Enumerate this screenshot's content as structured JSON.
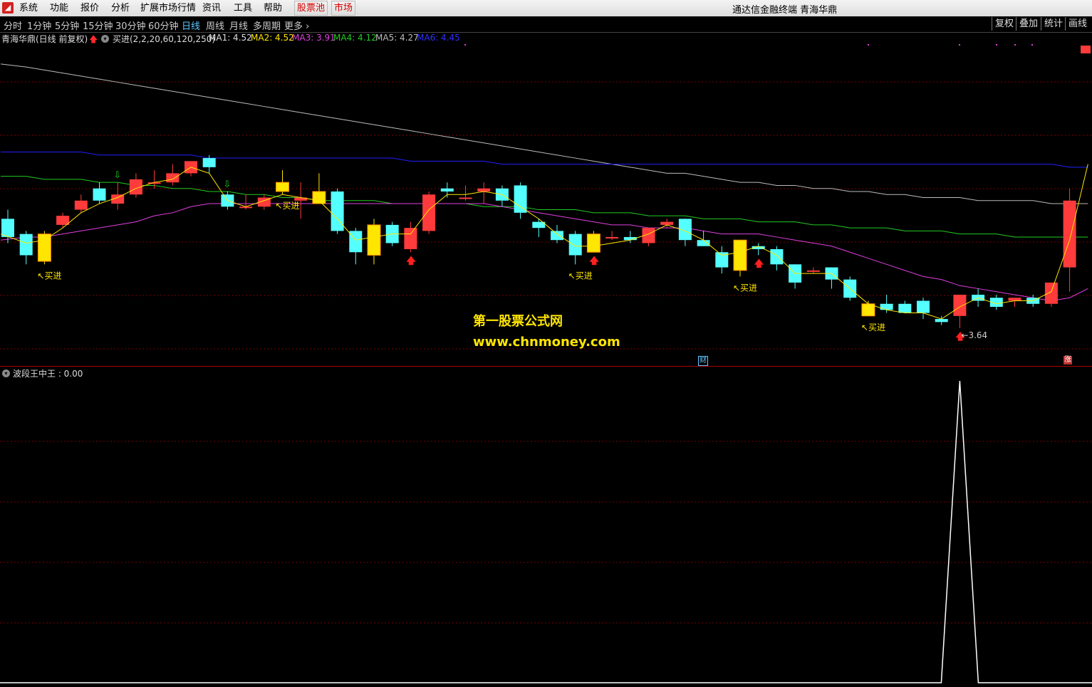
{
  "menubar": {
    "items": [
      "系统",
      "功能",
      "报价",
      "分析",
      "扩展市场行情",
      "资讯",
      "工具",
      "帮助"
    ],
    "stock_pool": "股票池",
    "market": "市场",
    "title": "通达信金融终端  青海华鼎"
  },
  "periods": [
    "分时",
    "1分钟",
    "5分钟",
    "15分钟",
    "30分钟",
    "60分钟",
    "日线",
    "周线",
    "月线",
    "多周期",
    "更多"
  ],
  "active_period": "日线",
  "tools": [
    "复权",
    "叠加",
    "统计",
    "画线"
  ],
  "legend": {
    "stock": "青海华鼎(日线 前复权)",
    "formula": "买进(2,2,20,60,120,250)",
    "ma1": "MA1: 4.52",
    "ma2": "MA2: 4.52",
    "ma3": "MA3: 3.91",
    "ma4": "MA4: 4.12",
    "ma5": "MA5: 4.27",
    "ma6": "MA6: 4.45"
  },
  "colors": {
    "up": "#ff3b3b",
    "down": "#54ffff",
    "signal": "#ffe600",
    "ma3": "#e040e0",
    "ma4": "#22cc22",
    "ma6": "#2020ff",
    "ma_gray": "#bbbbbb"
  },
  "watermark": {
    "line1": "第一股票公式网",
    "line2": "www.chnmoney.com"
  },
  "buy_label": "买进",
  "low_price": "3.64",
  "badges": {
    "cai": "财",
    "zhang": "涨"
  },
  "indicator": {
    "label": "波段王中王 : 0.00"
  },
  "chart_data": {
    "type": "candlestick",
    "candles": [
      {
        "o": 4.64,
        "h": 4.67,
        "l": 4.56,
        "c": 4.58
      },
      {
        "o": 4.59,
        "h": 4.6,
        "l": 4.49,
        "c": 4.52
      },
      {
        "o": 4.5,
        "h": 4.6,
        "l": 4.49,
        "c": 4.59,
        "hl": true
      },
      {
        "o": 4.62,
        "h": 4.66,
        "l": 4.61,
        "c": 4.65
      },
      {
        "o": 4.67,
        "h": 4.72,
        "l": 4.66,
        "c": 4.7
      },
      {
        "o": 4.74,
        "h": 4.76,
        "l": 4.69,
        "c": 4.7
      },
      {
        "o": 4.69,
        "h": 4.76,
        "l": 4.67,
        "c": 4.72
      },
      {
        "o": 4.72,
        "h": 4.79,
        "l": 4.71,
        "c": 4.77
      },
      {
        "o": 4.76,
        "h": 4.8,
        "l": 4.74,
        "c": 4.76
      },
      {
        "o": 4.76,
        "h": 4.82,
        "l": 4.75,
        "c": 4.79
      },
      {
        "o": 4.79,
        "h": 4.83,
        "l": 4.78,
        "c": 4.83
      },
      {
        "o": 4.84,
        "h": 4.85,
        "l": 4.79,
        "c": 4.81
      },
      {
        "o": 4.72,
        "h": 4.73,
        "l": 4.67,
        "c": 4.68
      },
      {
        "o": 4.68,
        "h": 4.72,
        "l": 4.67,
        "c": 4.68
      },
      {
        "o": 4.68,
        "h": 4.72,
        "l": 4.67,
        "c": 4.71
      },
      {
        "o": 4.76,
        "h": 4.8,
        "l": 4.72,
        "c": 4.73,
        "hl": true
      },
      {
        "o": 4.7,
        "h": 4.76,
        "l": 4.64,
        "c": 4.71
      },
      {
        "o": 4.73,
        "h": 4.79,
        "l": 4.7,
        "c": 4.69,
        "hl": true
      },
      {
        "o": 4.73,
        "h": 4.74,
        "l": 4.59,
        "c": 4.6
      },
      {
        "o": 4.6,
        "h": 4.61,
        "l": 4.49,
        "c": 4.53
      },
      {
        "o": 4.52,
        "h": 4.64,
        "l": 4.49,
        "c": 4.62,
        "hl": true
      },
      {
        "o": 4.62,
        "h": 4.63,
        "l": 4.55,
        "c": 4.56
      },
      {
        "o": 4.54,
        "h": 4.63,
        "l": 4.53,
        "c": 4.61
      },
      {
        "o": 4.6,
        "h": 4.73,
        "l": 4.59,
        "c": 4.72
      },
      {
        "o": 4.74,
        "h": 4.76,
        "l": 4.71,
        "c": 4.73
      },
      {
        "o": 4.71,
        "h": 4.75,
        "l": 4.7,
        "c": 4.71
      },
      {
        "o": 4.73,
        "h": 4.76,
        "l": 4.69,
        "c": 4.74
      },
      {
        "o": 4.74,
        "h": 4.75,
        "l": 4.68,
        "c": 4.7
      },
      {
        "o": 4.75,
        "h": 4.76,
        "l": 4.64,
        "c": 4.66
      },
      {
        "o": 4.63,
        "h": 4.64,
        "l": 4.58,
        "c": 4.61
      },
      {
        "o": 4.6,
        "h": 4.62,
        "l": 4.56,
        "c": 4.57
      },
      {
        "o": 4.59,
        "h": 4.6,
        "l": 4.49,
        "c": 4.52
      },
      {
        "o": 4.59,
        "h": 4.6,
        "l": 4.53,
        "c": 4.53,
        "hl": true
      },
      {
        "o": 4.58,
        "h": 4.6,
        "l": 4.57,
        "c": 4.58
      },
      {
        "o": 4.58,
        "h": 4.6,
        "l": 4.56,
        "c": 4.57
      },
      {
        "o": 4.56,
        "h": 4.61,
        "l": 4.55,
        "c": 4.61
      },
      {
        "o": 4.62,
        "h": 4.64,
        "l": 4.61,
        "c": 4.63
      },
      {
        "o": 4.64,
        "h": 4.64,
        "l": 4.55,
        "c": 4.57
      },
      {
        "o": 4.57,
        "h": 4.6,
        "l": 4.55,
        "c": 4.55
      },
      {
        "o": 4.53,
        "h": 4.55,
        "l": 4.46,
        "c": 4.48
      },
      {
        "o": 4.47,
        "h": 4.57,
        "l": 4.45,
        "c": 4.57,
        "hl": true
      },
      {
        "o": 4.55,
        "h": 4.56,
        "l": 4.52,
        "c": 4.54
      },
      {
        "o": 4.54,
        "h": 4.55,
        "l": 4.47,
        "c": 4.49
      },
      {
        "o": 4.49,
        "h": 4.49,
        "l": 4.41,
        "c": 4.43
      },
      {
        "o": 4.47,
        "h": 4.48,
        "l": 4.46,
        "c": 4.47
      },
      {
        "o": 4.48,
        "h": 4.48,
        "l": 4.41,
        "c": 4.44
      },
      {
        "o": 4.44,
        "h": 4.45,
        "l": 4.37,
        "c": 4.38
      },
      {
        "o": 4.36,
        "h": 4.37,
        "l": 4.32,
        "c": 4.32,
        "hl": true
      },
      {
        "o": 4.36,
        "h": 4.39,
        "l": 4.33,
        "c": 4.34
      },
      {
        "o": 4.36,
        "h": 4.37,
        "l": 4.33,
        "c": 4.33
      },
      {
        "o": 4.37,
        "h": 4.38,
        "l": 4.31,
        "c": 4.33
      },
      {
        "o": 4.31,
        "h": 4.32,
        "l": 4.29,
        "c": 4.3
      },
      {
        "o": 4.32,
        "h": 4.39,
        "l": 4.28,
        "c": 4.39
      },
      {
        "o": 4.39,
        "h": 4.41,
        "l": 4.35,
        "c": 4.37
      },
      {
        "o": 4.38,
        "h": 4.39,
        "l": 4.34,
        "c": 4.35
      },
      {
        "o": 4.37,
        "h": 4.38,
        "l": 4.35,
        "c": 4.38
      },
      {
        "o": 4.38,
        "h": 4.39,
        "l": 4.35,
        "c": 4.36
      },
      {
        "o": 4.36,
        "h": 4.43,
        "l": 4.35,
        "c": 4.43
      },
      {
        "o": 4.48,
        "h": 4.74,
        "l": 4.4,
        "c": 4.7
      }
    ],
    "ma_fast": [
      4.59,
      4.56,
      4.57,
      4.61,
      4.66,
      4.69,
      4.71,
      4.74,
      4.76,
      4.77,
      4.81,
      4.79,
      4.7,
      4.68,
      4.7,
      4.72,
      4.71,
      4.7,
      4.64,
      4.57,
      4.58,
      4.59,
      4.59,
      4.67,
      4.72,
      4.72,
      4.73,
      4.72,
      4.68,
      4.64,
      4.59,
      4.55,
      4.55,
      4.56,
      4.57,
      4.59,
      4.62,
      4.6,
      4.57,
      4.52,
      4.53,
      4.55,
      4.52,
      4.46,
      4.46,
      4.46,
      4.41,
      4.36,
      4.34,
      4.33,
      4.33,
      4.31,
      4.35,
      4.38,
      4.36,
      4.37,
      4.37,
      4.4,
      4.57,
      4.82
    ],
    "ma3": [
      4.57,
      4.58,
      4.58,
      4.59,
      4.6,
      4.61,
      4.62,
      4.63,
      4.65,
      4.66,
      4.68,
      4.69,
      4.69,
      4.69,
      4.69,
      4.69,
      4.69,
      4.69,
      4.69,
      4.69,
      4.69,
      4.69,
      4.69,
      4.69,
      4.69,
      4.69,
      4.69,
      4.68,
      4.67,
      4.66,
      4.65,
      4.64,
      4.63,
      4.62,
      4.62,
      4.61,
      4.61,
      4.61,
      4.6,
      4.59,
      4.59,
      4.59,
      4.58,
      4.57,
      4.56,
      4.55,
      4.53,
      4.51,
      4.49,
      4.47,
      4.45,
      4.44,
      4.42,
      4.41,
      4.4,
      4.39,
      4.38,
      4.37,
      4.38,
      4.41
    ],
    "ma4": [
      4.78,
      4.78,
      4.77,
      4.77,
      4.77,
      4.76,
      4.76,
      4.75,
      4.75,
      4.74,
      4.74,
      4.73,
      4.73,
      4.72,
      4.72,
      4.71,
      4.71,
      4.7,
      4.7,
      4.7,
      4.7,
      4.69,
      4.69,
      4.69,
      4.69,
      4.69,
      4.68,
      4.68,
      4.68,
      4.67,
      4.67,
      4.67,
      4.66,
      4.66,
      4.66,
      4.65,
      4.65,
      4.65,
      4.64,
      4.64,
      4.64,
      4.63,
      4.63,
      4.63,
      4.62,
      4.62,
      4.61,
      4.61,
      4.61,
      4.6,
      4.6,
      4.6,
      4.59,
      4.59,
      4.59,
      4.58,
      4.58,
      4.58,
      4.58,
      4.58
    ],
    "ma6": [
      4.86,
      4.86,
      4.86,
      4.86,
      4.86,
      4.85,
      4.85,
      4.85,
      4.85,
      4.85,
      4.85,
      4.84,
      4.84,
      4.84,
      4.84,
      4.84,
      4.84,
      4.84,
      4.84,
      4.84,
      4.84,
      4.84,
      4.83,
      4.83,
      4.83,
      4.83,
      4.83,
      4.82,
      4.82,
      4.82,
      4.82,
      4.82,
      4.82,
      4.82,
      4.82,
      4.82,
      4.82,
      4.82,
      4.82,
      4.82,
      4.82,
      4.82,
      4.82,
      4.82,
      4.82,
      4.82,
      4.82,
      4.82,
      4.82,
      4.82,
      4.82,
      4.82,
      4.82,
      4.82,
      4.82,
      4.82,
      4.82,
      4.82,
      4.81,
      4.81
    ],
    "ma_gray": [
      5.15,
      5.14,
      5.13,
      5.12,
      5.11,
      5.1,
      5.09,
      5.08,
      5.07,
      5.06,
      5.05,
      5.04,
      5.03,
      5.02,
      5.01,
      5.0,
      4.99,
      4.98,
      4.97,
      4.96,
      4.95,
      4.94,
      4.93,
      4.92,
      4.91,
      4.9,
      4.89,
      4.88,
      4.87,
      4.86,
      4.85,
      4.84,
      4.83,
      4.82,
      4.81,
      4.8,
      4.79,
      4.79,
      4.78,
      4.77,
      4.76,
      4.76,
      4.75,
      4.75,
      4.74,
      4.74,
      4.73,
      4.73,
      4.72,
      4.72,
      4.71,
      4.71,
      4.71,
      4.7,
      4.7,
      4.7,
      4.7,
      4.69,
      4.69,
      4.69
    ],
    "buy_signals": [
      2,
      15,
      31,
      40,
      47
    ],
    "up_arrows": [
      22,
      32,
      41,
      52
    ],
    "down_arrows": [
      6,
      12
    ],
    "indicator_spike_index": 52,
    "indicator_value": 0.0
  }
}
